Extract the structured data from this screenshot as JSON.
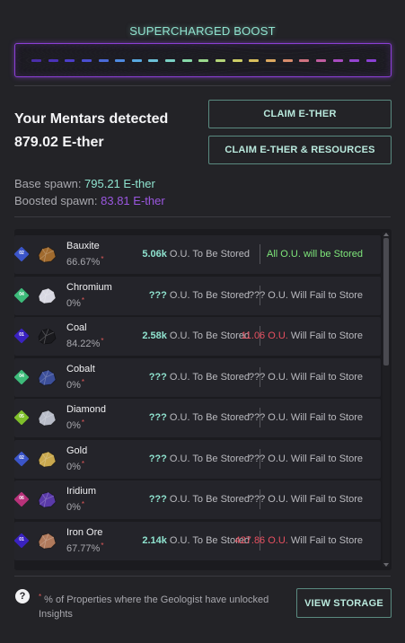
{
  "boost": {
    "title": "SUPERCHARGED BOOST",
    "dash_colors": [
      "#4a2ea8",
      "#4a32b8",
      "#4b3ec8",
      "#4a4ed0",
      "#4a6ad8",
      "#4e8ae0",
      "#58a8e0",
      "#6cc0d8",
      "#7ad0c4",
      "#86d8a8",
      "#9ad88c",
      "#b4d478",
      "#cccc66",
      "#d8be5c",
      "#dca860",
      "#d88c6c",
      "#d07280",
      "#c05ca0",
      "#a84cc0",
      "#9444d0",
      "#8a40d4"
    ],
    "border_color": "#8b3fd6"
  },
  "summary": {
    "title": "Your Mentars detected",
    "amount": "879.02 E-ther",
    "base_label": "Base spawn: ",
    "base_value": "795.21 E-ther",
    "boosted_label": "Boosted spawn: ",
    "boosted_value": "83.81 E-ther"
  },
  "buttons": {
    "claim": "CLAIM E-THER",
    "claim_resources": "CLAIM E-THER & RESOURCES",
    "view_storage": "VIEW STORAGE"
  },
  "resources": [
    {
      "tier": "02",
      "tier_color": "#3b55c9",
      "icon": "bauxite-ore-icon",
      "ore_color": "#a06a2e",
      "name": "Bauxite",
      "pct": "66.67%",
      "stored_num": "5.06k",
      "stored_text": " O.U. To Be Stored",
      "fail_num": "",
      "fail_text": "All O.U. will be Stored",
      "fail_ok": true
    },
    {
      "tier": "04",
      "tier_color": "#3dbb7a",
      "icon": "chromium-ore-icon",
      "ore_color": "#d8d8e2",
      "name": "Chromium",
      "pct": "0%",
      "stored_num": "???",
      "stored_text": " O.U. To Be Stored",
      "fail_num": "???",
      "fail_text": " O.U. Will Fail to Store",
      "fail_ok": false
    },
    {
      "tier": "01",
      "tier_color": "#3a22c0",
      "icon": "coal-ore-icon",
      "ore_color": "#1a1a1e",
      "name": "Coal",
      "pct": "84.22%",
      "stored_num": "2.58k",
      "stored_text": " O.U. To Be Stored",
      "fail_num": "11.06 O.U.",
      "fail_text": " Will Fail to Store",
      "fail_ok": false
    },
    {
      "tier": "04",
      "tier_color": "#3dbb7a",
      "icon": "cobalt-ore-icon",
      "ore_color": "#3c4f9a",
      "name": "Cobalt",
      "pct": "0%",
      "stored_num": "???",
      "stored_text": " O.U. To Be Stored",
      "fail_num": "???",
      "fail_text": " O.U. Will Fail to Store",
      "fail_ok": false
    },
    {
      "tier": "05",
      "tier_color": "#7fbf2a",
      "icon": "diamond-ore-icon",
      "ore_color": "#b8bcc8",
      "name": "Diamond",
      "pct": "0%",
      "stored_num": "???",
      "stored_text": " O.U. To Be Stored",
      "fail_num": "???",
      "fail_text": " O.U. Will Fail to Store",
      "fail_ok": false
    },
    {
      "tier": "02",
      "tier_color": "#3b55c9",
      "icon": "gold-ore-icon",
      "ore_color": "#c9a84e",
      "name": "Gold",
      "pct": "0%",
      "stored_num": "???",
      "stored_text": " O.U. To Be Stored",
      "fail_num": "???",
      "fail_text": " O.U. Will Fail to Store",
      "fail_ok": false
    },
    {
      "tier": "06",
      "tier_color": "#b8327a",
      "icon": "iridium-ore-icon",
      "ore_color": "#5a3aa8",
      "name": "Iridium",
      "pct": "0%",
      "stored_num": "???",
      "stored_text": " O.U. To Be Stored",
      "fail_num": "???",
      "fail_text": " O.U. Will Fail to Store",
      "fail_ok": false
    },
    {
      "tier": "01",
      "tier_color": "#3a22c0",
      "icon": "iron-ore-icon",
      "ore_color": "#b07a5c",
      "name": "Iron Ore",
      "pct": "67.77%",
      "stored_num": "2.14k",
      "stored_text": " O.U. To Be Stored",
      "fail_num": "427.86 O.U.",
      "fail_text": " Will Fail to Store",
      "fail_ok": false
    }
  ],
  "footer": {
    "help_glyph": "?",
    "footnote_star": "*",
    "footnote": " % of Properties where the Geologist have unlocked Insights"
  }
}
